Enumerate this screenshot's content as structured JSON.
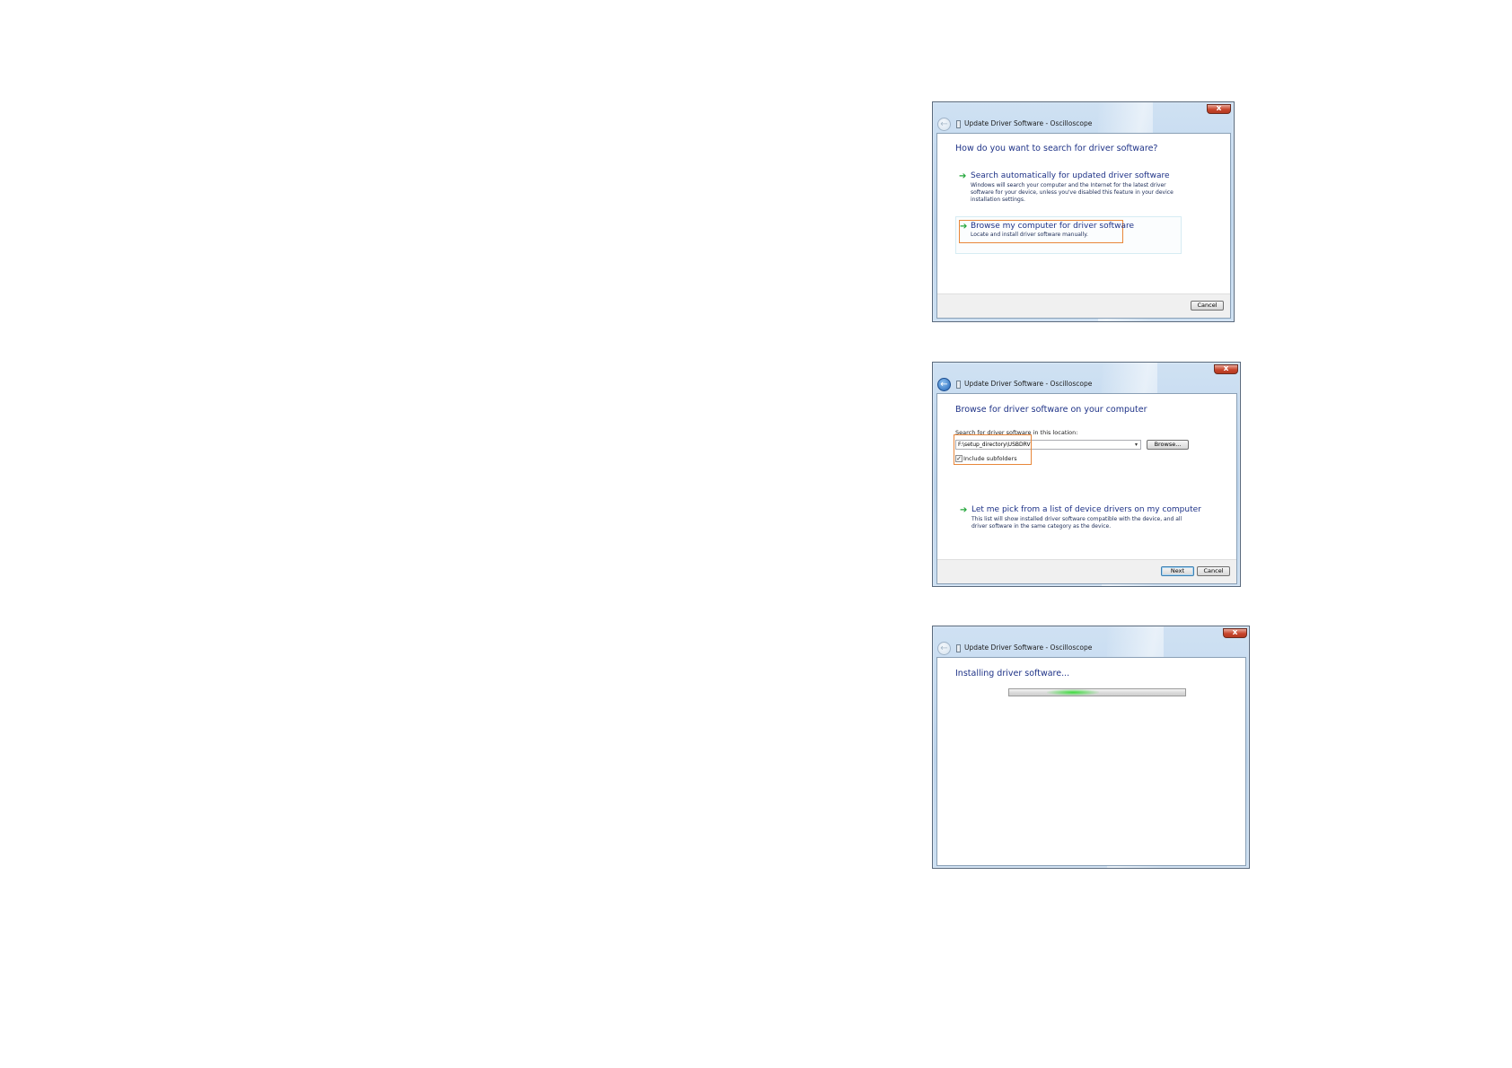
{
  "dialog1": {
    "title": "Update Driver Software - Oscilloscope",
    "close_label": "x",
    "heading": "How do you want to search for driver software?",
    "option1": {
      "title": "Search automatically for updated driver software",
      "description": "Windows will search your computer and the Internet for the latest driver software for your device, unless you've disabled this feature in your device installation settings."
    },
    "option2": {
      "title": "Browse my computer for driver software",
      "description": "Locate and install driver software manually."
    },
    "cancel_label": "Cancel"
  },
  "dialog2": {
    "title": "Update Driver Software - Oscilloscope",
    "close_label": "x",
    "heading": "Browse for driver software on your computer",
    "search_label": "Search for driver software in this location:",
    "path_value": "F:\\setup_directory\\USBDRV",
    "browse_label": "Browse...",
    "include_subfolders_label": "Include subfolders",
    "include_subfolders_checked": true,
    "pick_option": {
      "title": "Let me pick from a list of device drivers on my computer",
      "description": "This list will show installed driver software compatible with the device, and all driver software in the same category as the device."
    },
    "next_label": "Next",
    "cancel_label": "Cancel"
  },
  "dialog3": {
    "title": "Update Driver Software - Oscilloscope",
    "close_label": "x",
    "heading": "Installing driver software...",
    "progress_state": "indeterminate"
  },
  "icons": {
    "back": "back-arrow-icon",
    "device": "device-icon",
    "option_arrow": "green-arrow-icon",
    "close": "close-icon"
  },
  "colors": {
    "heading": "#1e3287",
    "option_arrow": "#23a63a",
    "highlight_box": "#e8873a",
    "close_button": "#c8452c"
  }
}
